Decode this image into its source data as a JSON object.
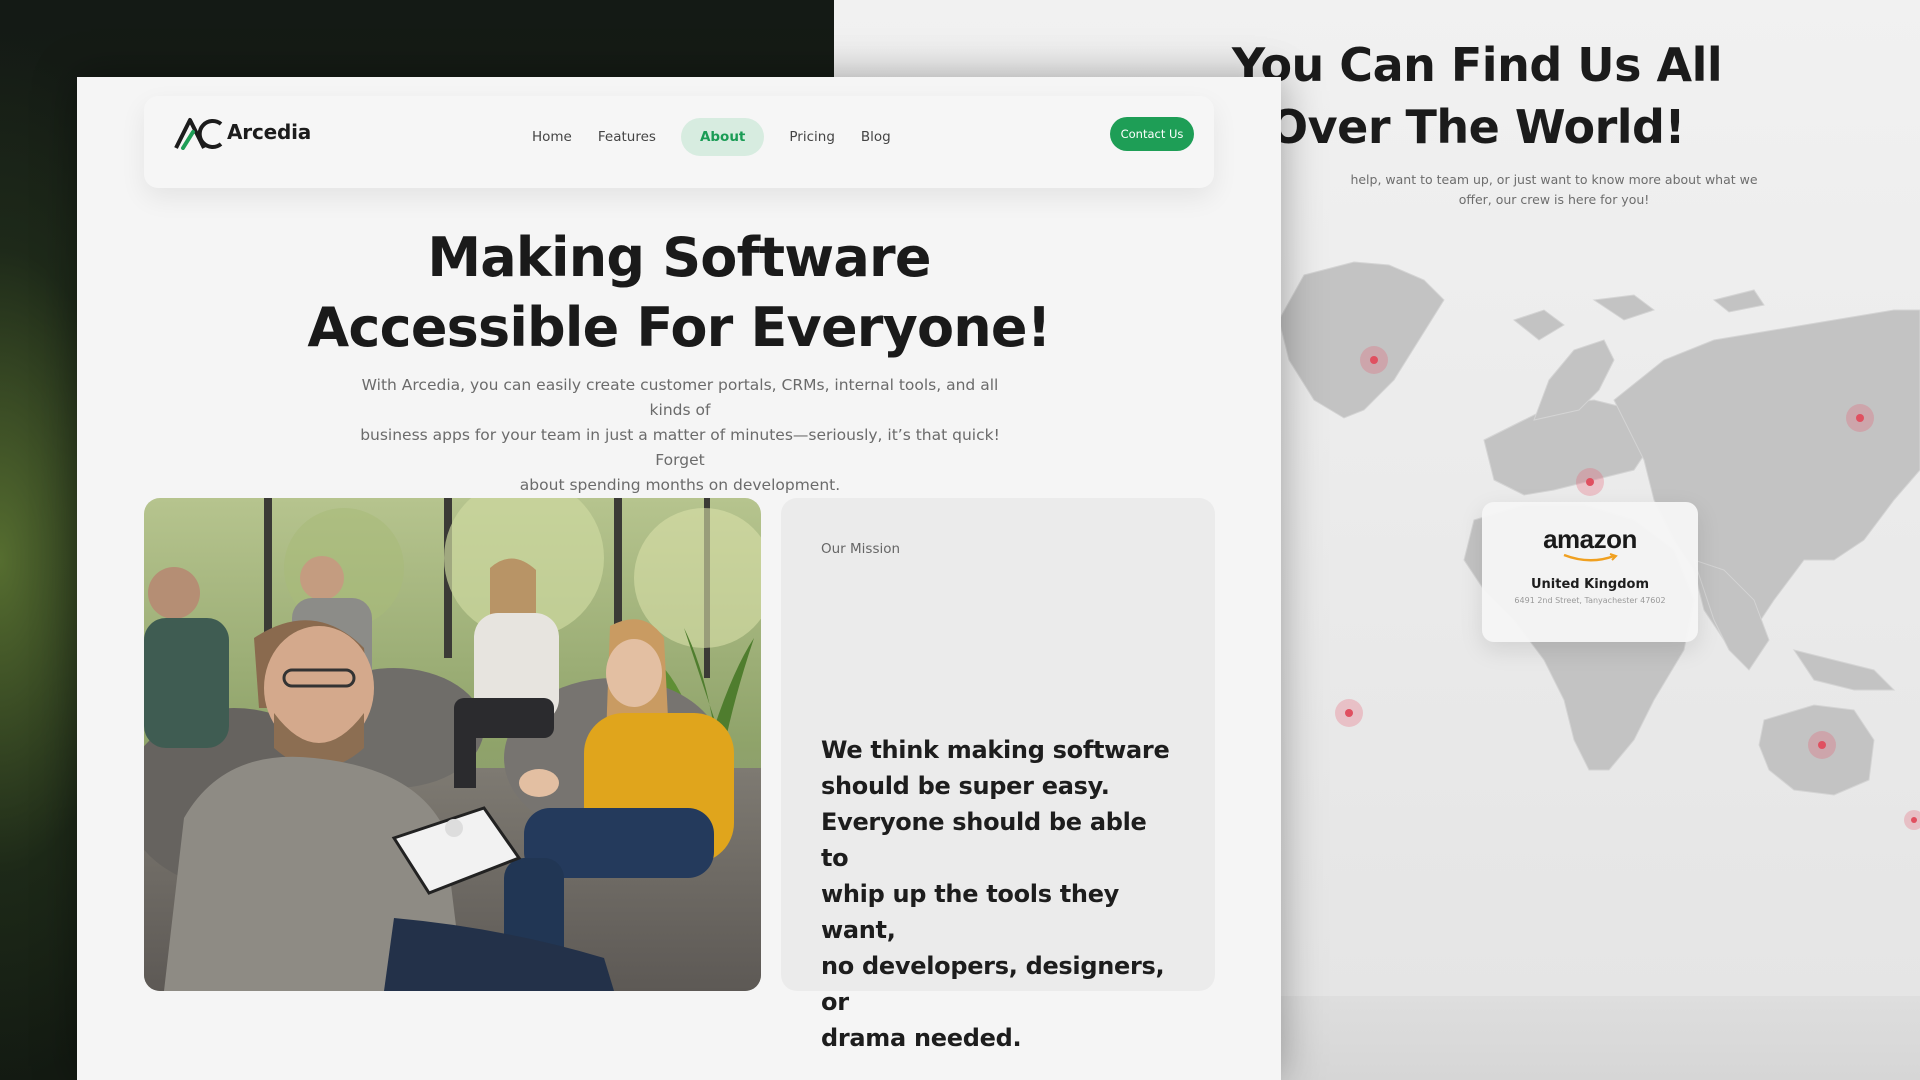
{
  "front_page": {
    "brand": {
      "name": "Arcedia",
      "logo_icon": "ac-monogram-icon"
    },
    "nav": {
      "links": [
        {
          "label": "Home",
          "active": false
        },
        {
          "label": "Features",
          "active": false
        },
        {
          "label": "About",
          "active": true
        },
        {
          "label": "Pricing",
          "active": false
        },
        {
          "label": "Blog",
          "active": false
        }
      ],
      "contact_button": "Contact Us"
    },
    "hero": {
      "title_lines": [
        "Making Software",
        "Accessible For Everyone!"
      ],
      "description_lines": [
        "With Arcedia, you can easily create customer portals, CRMs, internal tools, and all kinds of",
        "business apps for your team in just a matter of minutes—seriously, it’s that quick! Forget",
        "about spending months on development."
      ]
    },
    "mission": {
      "label": "Our Mission",
      "text_lines": [
        "We think making software",
        "should be super easy.",
        "Everyone should be able to",
        "whip up the tools they want,",
        "no developers, designers, or",
        "drama needed."
      ]
    }
  },
  "back_page": {
    "title_lines": [
      "You Can Find Us All",
      "Over The World!"
    ],
    "subtitle_lines": [
      "help, want to team up, or just want to know more about what we",
      "offer, our crew is here for you!"
    ],
    "location_card": {
      "company_logo_text": "amazon",
      "country": "United Kingdom",
      "address": "6491 2nd Street, Tanyachester 47602"
    },
    "map_pins": 6
  },
  "colors": {
    "accent_green": "#1e9e56",
    "active_tab_bg": "#d7ece0",
    "pin_red": "#e05060"
  }
}
